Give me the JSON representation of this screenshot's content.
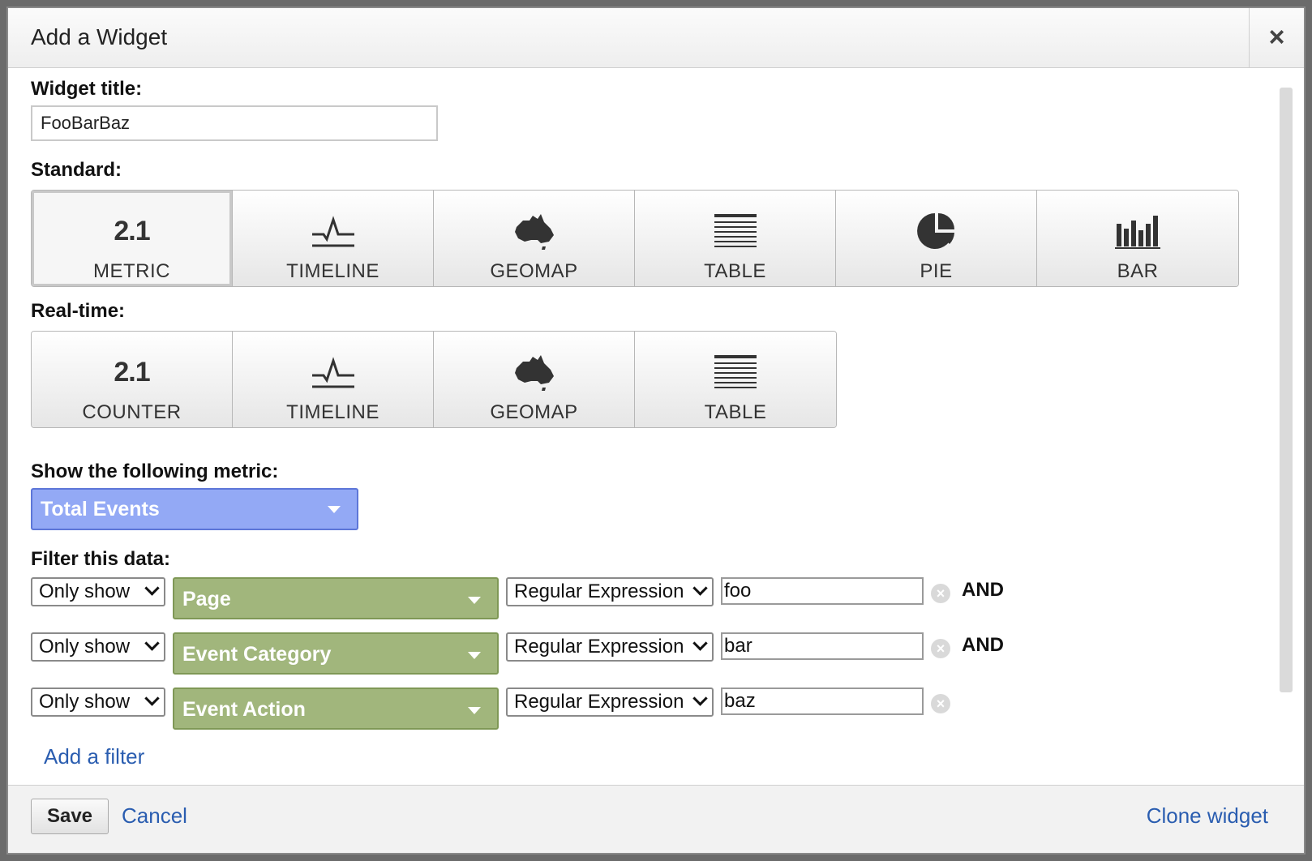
{
  "dialog": {
    "title": "Add a Widget",
    "close_label": "×"
  },
  "widget_title": {
    "label": "Widget title:",
    "value": "FooBarBaz"
  },
  "standard": {
    "label": "Standard:",
    "types": [
      {
        "label": "METRIC",
        "icon": "metric-number-icon",
        "icon_text": "2.1",
        "selected": true
      },
      {
        "label": "TIMELINE",
        "icon": "timeline-icon"
      },
      {
        "label": "GEOMAP",
        "icon": "australia-map-icon"
      },
      {
        "label": "TABLE",
        "icon": "table-icon"
      },
      {
        "label": "PIE",
        "icon": "pie-chart-icon"
      },
      {
        "label": "BAR",
        "icon": "bar-chart-icon"
      }
    ]
  },
  "realtime": {
    "label": "Real-time:",
    "types": [
      {
        "label": "COUNTER",
        "icon": "counter-number-icon",
        "icon_text": "2.1"
      },
      {
        "label": "TIMELINE",
        "icon": "timeline-icon"
      },
      {
        "label": "GEOMAP",
        "icon": "australia-map-icon"
      },
      {
        "label": "TABLE",
        "icon": "table-icon"
      }
    ]
  },
  "metric": {
    "label": "Show the following metric:",
    "selected": "Total Events",
    "color": "#93a9f5"
  },
  "filters": {
    "label": "Filter this data:",
    "dimension_color": "#a1b67c",
    "rows": [
      {
        "mode": "Only show",
        "dimension": "Page",
        "match": "Regular Expression",
        "value": "foo",
        "conjunction": "AND"
      },
      {
        "mode": "Only show",
        "dimension": "Event Category",
        "match": "Regular Expression",
        "value": "bar",
        "conjunction": "AND"
      },
      {
        "mode": "Only show",
        "dimension": "Event Action",
        "match": "Regular Expression",
        "value": "baz",
        "conjunction": ""
      }
    ],
    "add_filter": "Add a filter"
  },
  "footer": {
    "save": "Save",
    "cancel": "Cancel",
    "clone": "Clone widget"
  },
  "colors": {
    "link": "#2a5db0"
  }
}
